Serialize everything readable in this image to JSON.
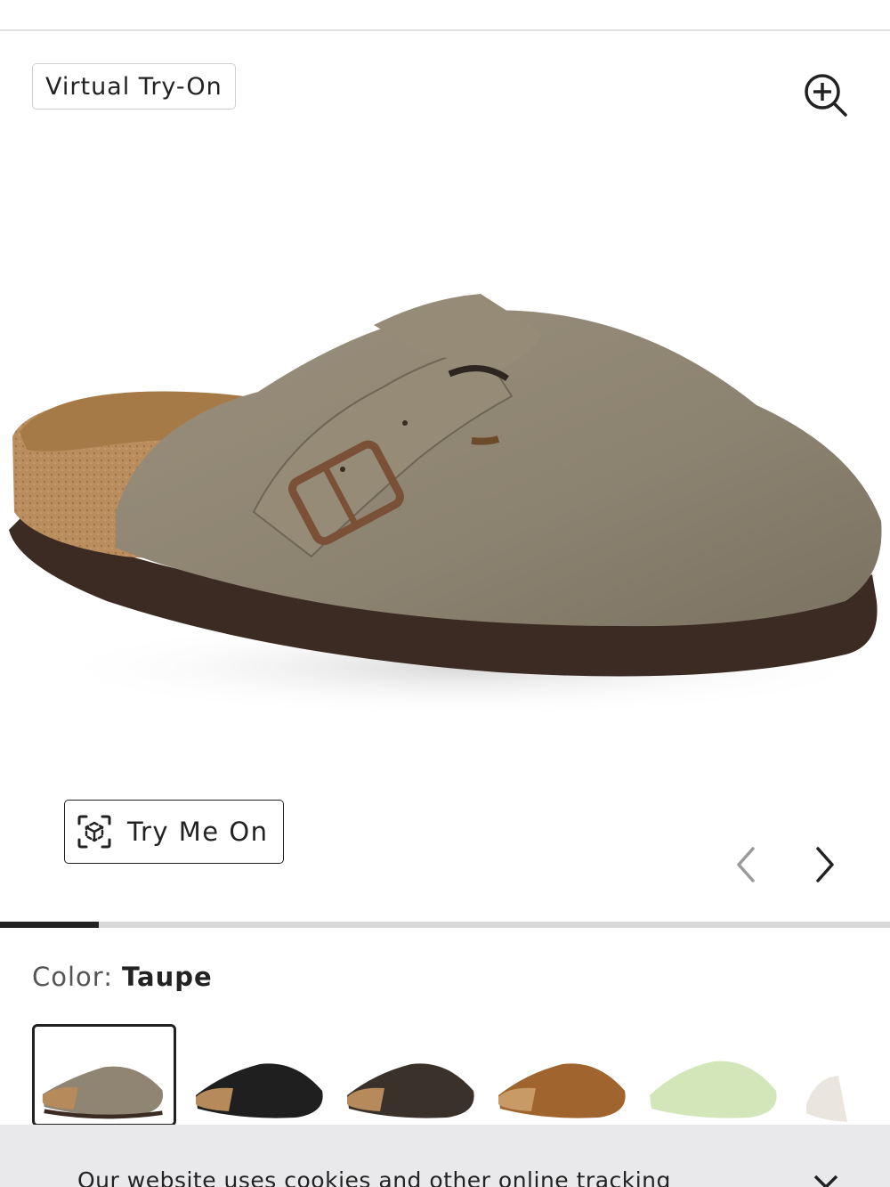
{
  "gallery": {
    "virtual_tryon_label": "Virtual Try-On",
    "tryme_label": "Try Me On",
    "image_position": {
      "current": 1,
      "total": 9
    }
  },
  "product": {
    "color_label": "Color:",
    "color_value": "Taupe",
    "swatches": [
      {
        "name": "Taupe",
        "selected": true
      },
      {
        "name": "Black",
        "selected": false
      },
      {
        "name": "Mocha",
        "selected": false
      },
      {
        "name": "Mink",
        "selected": false
      },
      {
        "name": "Faded Lime",
        "selected": false
      },
      {
        "name": "White",
        "selected": false
      }
    ]
  },
  "cookie": {
    "text": "Our website uses cookies and other online tracking"
  },
  "icons": {
    "zoom": "zoom-in-icon",
    "tryme": "ar-scan-icon",
    "prev": "chevron-left-icon",
    "next": "chevron-right-icon",
    "close": "close-icon"
  },
  "colors": {
    "suede_taupe": "#8f8572",
    "cork": "#b68a5b",
    "sole": "#3c2c24",
    "accent_dark": "#222222"
  }
}
